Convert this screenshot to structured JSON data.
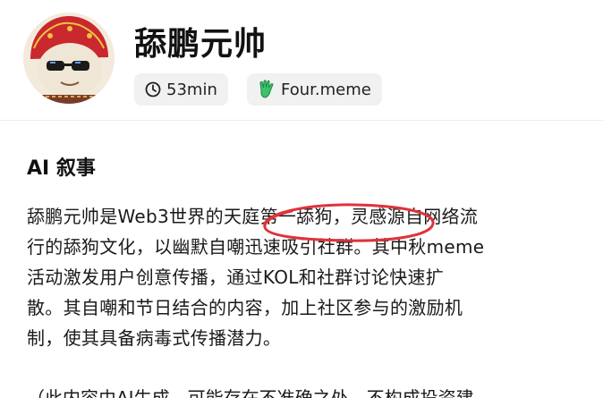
{
  "header": {
    "title": "舔鹏元帅",
    "avatar_icon": "lion-mascot-avatar-icon",
    "chips": [
      {
        "icon": "clock-icon",
        "label": "53min"
      },
      {
        "icon": "green-hand-icon",
        "label": "Four.meme"
      }
    ]
  },
  "section": {
    "title": "AI 叙事",
    "lines": [
      {
        "before": "舔鹏元帅是Web3世界的",
        "highlight": "天庭第一舔狗，",
        "after": "灵感源自网络流"
      },
      {
        "text": "行的舔狗文化，以幽默自嘲迅速吸引社群。其中秋meme"
      },
      {
        "text": "活动激发用户创意传播，通过KOL和社群讨论快速扩"
      },
      {
        "text": "散。其自嘲和节日结合的内容，加上社区参与的激励机"
      },
      {
        "text": "制，使其具备病毒式传播潜力。"
      }
    ],
    "cut_line": "（此内容由AI生成，可能存在不准确之处，不构成投资建"
  },
  "colors": {
    "annotation": "#e0323a",
    "chip_bg": "#f1f1f1",
    "hand_icon": "#3cc26a"
  }
}
